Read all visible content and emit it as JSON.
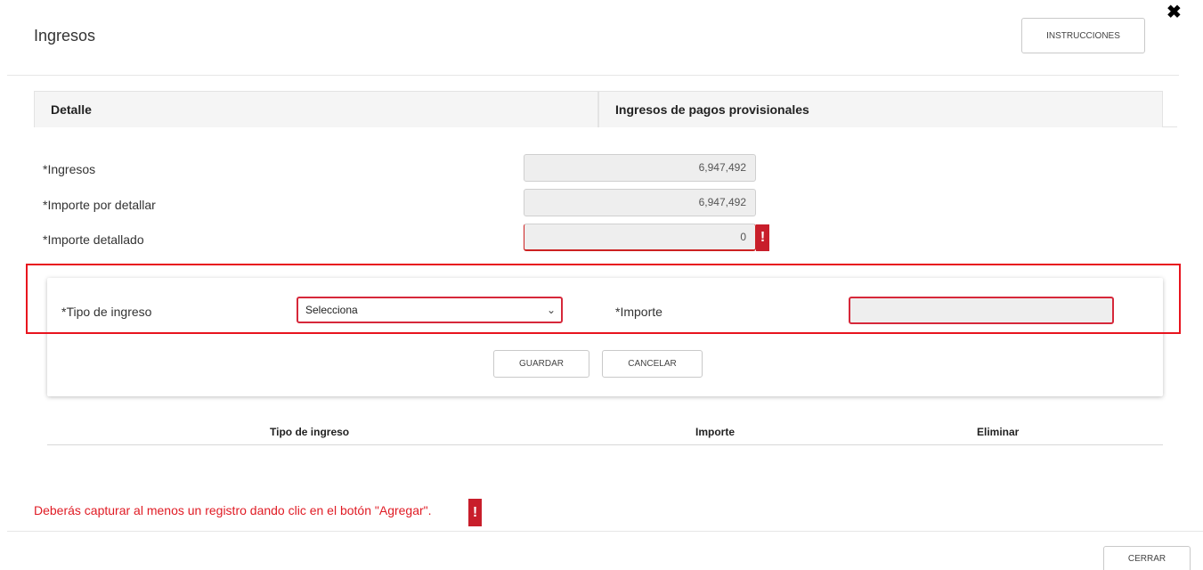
{
  "header": {
    "title": "Ingresos",
    "instructions_label": "INSTRUCCIONES",
    "close_glyph": "✖"
  },
  "tabs": [
    {
      "label": "Detalle"
    },
    {
      "label": "Ingresos de pagos provisionales"
    }
  ],
  "summary": {
    "ingresos_label": "*Ingresos",
    "ingresos_value": "6,947,492",
    "por_detallar_label": "*Importe por detallar",
    "por_detallar_value": "6,947,492",
    "detallado_label": "*Importe detallado",
    "detallado_value": "0",
    "error_glyph": "!"
  },
  "form": {
    "tipo_label": "*Tipo de ingreso",
    "tipo_selected": "Selecciona",
    "importe_label": "*Importe",
    "importe_value": "",
    "save_label": "GUARDAR",
    "cancel_label": "CANCELAR"
  },
  "table": {
    "columns": [
      "Tipo de ingreso",
      "Importe",
      "Eliminar"
    ]
  },
  "footer": {
    "error_message": "Deberás capturar al menos un registro dando clic en el botón \"Agregar\".",
    "error_glyph": "!",
    "close_label": "CERRAR"
  },
  "colors": {
    "error_red": "#e01b24",
    "badge_red": "#c81e2b",
    "readonly_bg": "#eeeeee"
  }
}
